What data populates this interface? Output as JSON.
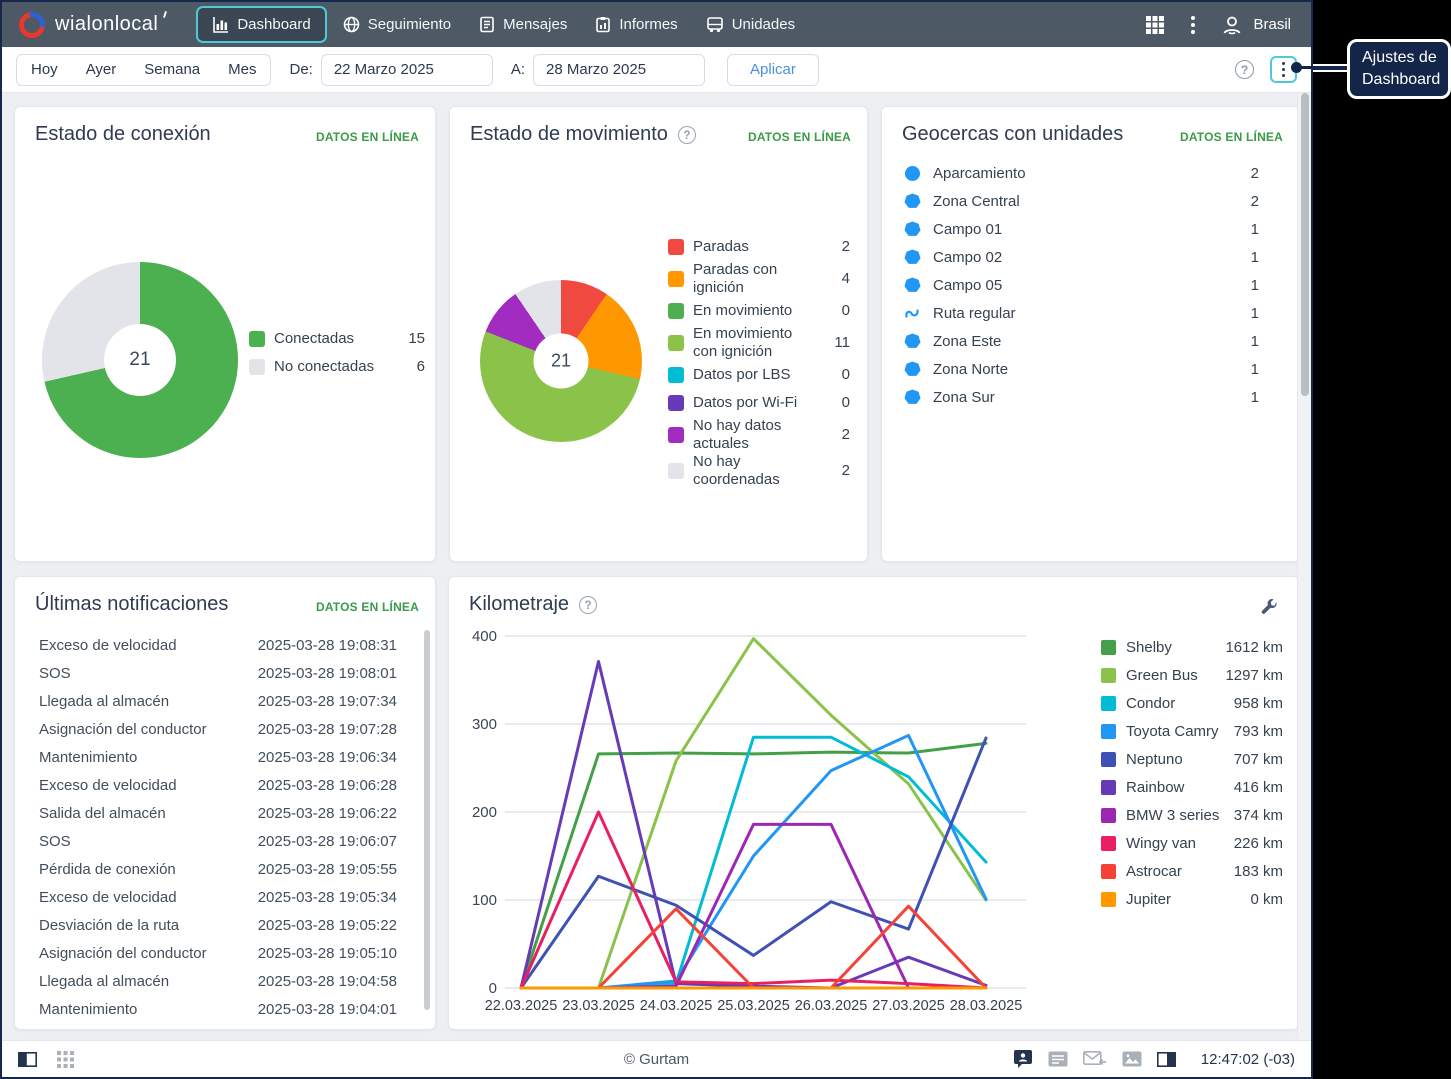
{
  "navbar": {
    "brand": "wialonlocal",
    "tabs": [
      {
        "label": "Dashboard",
        "active": true
      },
      {
        "label": "Seguimiento"
      },
      {
        "label": "Mensajes"
      },
      {
        "label": "Informes"
      },
      {
        "label": "Unidades"
      }
    ],
    "user": "Brasil"
  },
  "filterbar": {
    "presets": [
      {
        "label": "Hoy"
      },
      {
        "label": "Ayer"
      },
      {
        "label": "Semana"
      },
      {
        "label": "Mes"
      }
    ],
    "from_label": "De:",
    "from_value": "22 Marzo 2025",
    "to_label": "A:",
    "to_value": "28 Marzo 2025",
    "apply_label": "Aplicar"
  },
  "callout": {
    "line1": "Ajustes de",
    "line2": "Dashboard"
  },
  "badge_online": "DATOS EN LÍNEA",
  "connection": {
    "title": "Estado de conexión",
    "total": "21",
    "segments": [
      {
        "label": "Conectadas",
        "value": 15,
        "color": "#4caf50"
      },
      {
        "label": "No conectadas",
        "value": 6,
        "color": "#e2e4e9"
      }
    ]
  },
  "movement": {
    "title": "Estado de movimiento",
    "total": "21",
    "segments": [
      {
        "label": "Paradas",
        "value": 2,
        "color": "#f0493f"
      },
      {
        "label": "Paradas con ignición",
        "value": 4,
        "color": "#ff9800"
      },
      {
        "label": "En movimiento",
        "value": 0,
        "color": "#4caf50"
      },
      {
        "label": "En movimiento con ignición",
        "value": 11,
        "color": "#8bc34a"
      },
      {
        "label": "Datos por LBS",
        "value": 0,
        "color": "#00bcd4"
      },
      {
        "label": "Datos por Wi-Fi",
        "value": 0,
        "color": "#673ab7"
      },
      {
        "label": "No hay datos actuales",
        "value": 2,
        "color": "#a32cc0"
      },
      {
        "label": "No hay coordenadas",
        "value": 2,
        "color": "#e2e4e9"
      }
    ]
  },
  "geofences": {
    "title": "Geocercas con unidades",
    "items": [
      {
        "icon": "circle",
        "label": "Aparcamiento",
        "count": "2"
      },
      {
        "icon": "polygon",
        "label": "Zona Central",
        "count": "2"
      },
      {
        "icon": "polygon",
        "label": "Campo 01",
        "count": "1"
      },
      {
        "icon": "polygon",
        "label": "Campo 02",
        "count": "1"
      },
      {
        "icon": "polygon",
        "label": "Campo 05",
        "count": "1"
      },
      {
        "icon": "route",
        "label": "Ruta regular",
        "count": "1"
      },
      {
        "icon": "polygon",
        "label": "Zona Este",
        "count": "1"
      },
      {
        "icon": "polygon",
        "label": "Zona Norte",
        "count": "1"
      },
      {
        "icon": "polygon",
        "label": "Zona Sur",
        "count": "1"
      }
    ]
  },
  "notifications": {
    "title": "Últimas notificaciones",
    "items": [
      {
        "label": "Exceso de velocidad",
        "time": "2025-03-28 19:08:31"
      },
      {
        "label": "SOS",
        "time": "2025-03-28 19:08:01"
      },
      {
        "label": "Llegada al almacén",
        "time": "2025-03-28 19:07:34"
      },
      {
        "label": "Asignación del conductor",
        "time": "2025-03-28 19:07:28"
      },
      {
        "label": "Mantenimiento",
        "time": "2025-03-28 19:06:34"
      },
      {
        "label": "Exceso de velocidad",
        "time": "2025-03-28 19:06:28"
      },
      {
        "label": "Salida del almacén",
        "time": "2025-03-28 19:06:22"
      },
      {
        "label": "SOS",
        "time": "2025-03-28 19:06:07"
      },
      {
        "label": "Pérdida de conexión",
        "time": "2025-03-28 19:05:55"
      },
      {
        "label": "Exceso de velocidad",
        "time": "2025-03-28 19:05:34"
      },
      {
        "label": "Desviación de la ruta",
        "time": "2025-03-28 19:05:22"
      },
      {
        "label": "Asignación del conductor",
        "time": "2025-03-28 19:05:10"
      },
      {
        "label": "Llegada al almacén",
        "time": "2025-03-28 19:04:58"
      },
      {
        "label": "Mantenimiento",
        "time": "2025-03-28 19:04:01"
      }
    ]
  },
  "mileage": {
    "title": "Kilometraje"
  },
  "chart_data": {
    "type": "line",
    "title": "Kilometraje",
    "x": [
      "22.03.2025",
      "23.03.2025",
      "24.03.2025",
      "25.03.2025",
      "26.03.2025",
      "27.03.2025",
      "28.03.2025"
    ],
    "ylim": [
      0,
      400
    ],
    "yticks": [
      0,
      100,
      200,
      300,
      400
    ],
    "grid": true,
    "legend_position": "right",
    "series": [
      {
        "name": "Shelby",
        "color": "#43a047",
        "total": "1612 km",
        "values": [
          0,
          266,
          267,
          266,
          268,
          267,
          278
        ]
      },
      {
        "name": "Green Bus",
        "color": "#8bc34a",
        "total": "1297 km",
        "values": [
          0,
          0,
          258,
          397,
          310,
          232,
          100
        ]
      },
      {
        "name": "Condor",
        "color": "#00bcd4",
        "total": "958 km",
        "values": [
          0,
          0,
          5,
          285,
          285,
          240,
          143
        ]
      },
      {
        "name": "Toyota Camry",
        "color": "#2196f3",
        "total": "793 km",
        "values": [
          0,
          0,
          8,
          150,
          247,
          287,
          101
        ]
      },
      {
        "name": "Neptuno",
        "color": "#3f51b5",
        "total": "707 km",
        "values": [
          0,
          127,
          94,
          37,
          98,
          67,
          284
        ]
      },
      {
        "name": "Rainbow",
        "color": "#673ab7",
        "total": "416 km",
        "values": [
          0,
          371,
          5,
          2,
          0,
          35,
          3
        ]
      },
      {
        "name": "BMW 3 series",
        "color": "#9c27b0",
        "total": "374 km",
        "values": [
          0,
          0,
          2,
          186,
          186,
          0,
          0
        ]
      },
      {
        "name": "Wingy van",
        "color": "#e91e63",
        "total": "226 km",
        "values": [
          0,
          200,
          7,
          5,
          9,
          5,
          0
        ]
      },
      {
        "name": "Astrocar",
        "color": "#f44336",
        "total": "183 km",
        "values": [
          0,
          0,
          90,
          0,
          0,
          93,
          0
        ]
      },
      {
        "name": "Jupiter",
        "color": "#ff9800",
        "total": "0 km",
        "values": [
          0,
          0,
          0,
          0,
          0,
          0,
          0
        ]
      }
    ]
  },
  "footer": {
    "copyright": "© Gurtam",
    "time": "12:47:02 (-03)"
  }
}
